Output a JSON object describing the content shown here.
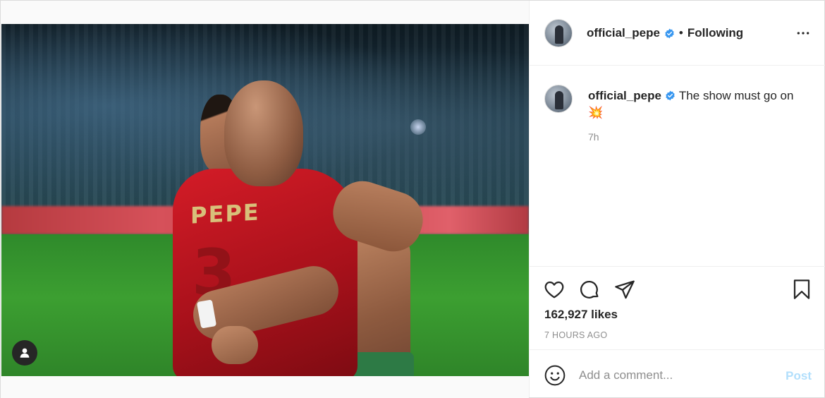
{
  "post": {
    "author": {
      "username": "official_pepe",
      "verified": true
    },
    "follow_status": "Following",
    "separator": "•",
    "caption": {
      "text": "The show must go on",
      "emoji": "💥",
      "time": "7h"
    },
    "likes": "162,927 likes",
    "time_ago": "7 HOURS AGO",
    "image": {
      "jersey_name": "PEPE",
      "jersey_number": "3"
    }
  },
  "comment_box": {
    "placeholder": "Add a comment...",
    "post_label": "Post"
  },
  "icons": {
    "more": "more-options-icon",
    "like": "heart-icon",
    "comment": "comment-icon",
    "share": "share-icon",
    "save": "bookmark-icon",
    "emoji": "smiley-icon",
    "user_tag": "user-tag-icon",
    "verified": "verified-badge-icon"
  },
  "colors": {
    "verified_blue": "#3897f0",
    "post_button_disabled": "#b2dffc",
    "muted_text": "#8e8e8e"
  }
}
